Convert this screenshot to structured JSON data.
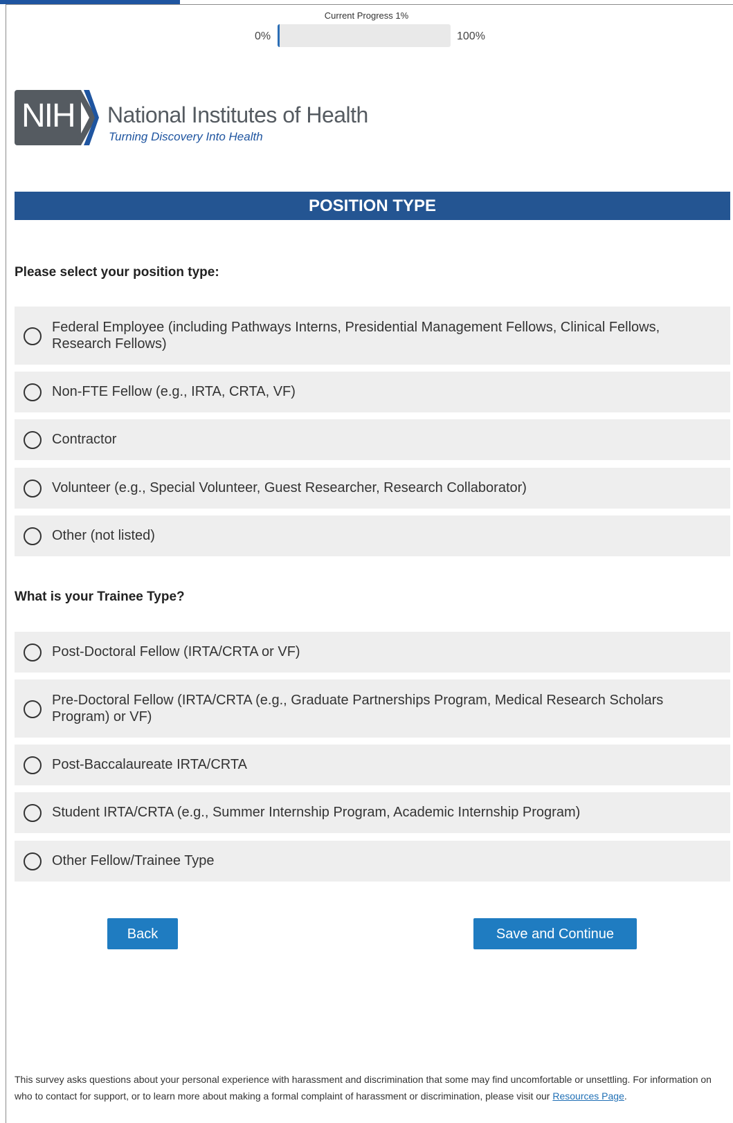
{
  "progress": {
    "label": "Current Progress 1%",
    "value_percent": 1,
    "start_label": "0%",
    "end_label": "100%"
  },
  "logo": {
    "letters": "NIH",
    "name": "National Institutes of Health",
    "tagline": "Turning Discovery Into Health"
  },
  "section": {
    "title": "POSITION TYPE"
  },
  "question1": {
    "prompt": "Please select your position type:",
    "options": [
      "Federal Employee (including Pathways Interns, Presidential Management Fellows, Clinical Fellows, Research Fellows)",
      "Non-FTE Fellow (e.g., IRTA, CRTA, VF)",
      "Contractor",
      "Volunteer (e.g., Special Volunteer, Guest Researcher, Research Collaborator)",
      "Other (not listed)"
    ]
  },
  "question2": {
    "prompt": "What is your Trainee Type?",
    "options": [
      "Post-Doctoral Fellow (IRTA/CRTA or VF)",
      "Pre-Doctoral Fellow (IRTA/CRTA (e.g., Graduate Partnerships Program, Medical Research Scholars Program) or VF)",
      "Post-Baccalaureate IRTA/CRTA",
      "Student IRTA/CRTA (e.g., Summer Internship Program, Academic Internship Program)",
      "Other Fellow/Trainee Type"
    ]
  },
  "buttons": {
    "back": "Back",
    "save_continue": "Save and Continue"
  },
  "disclaimer": {
    "text": "This survey asks questions about your personal experience with harassment and discrimination that some may find uncomfortable or unsettling. For information on who to contact for support, or to learn more about making a formal complaint of harassment or discrimination, please visit our ",
    "link": "Resources Page",
    "end": "."
  },
  "colors": {
    "header_bg": "#245592",
    "button_bg": "#1f7cc1",
    "option_bg": "#eeeeee",
    "progress_fill": "#2a6db5"
  }
}
